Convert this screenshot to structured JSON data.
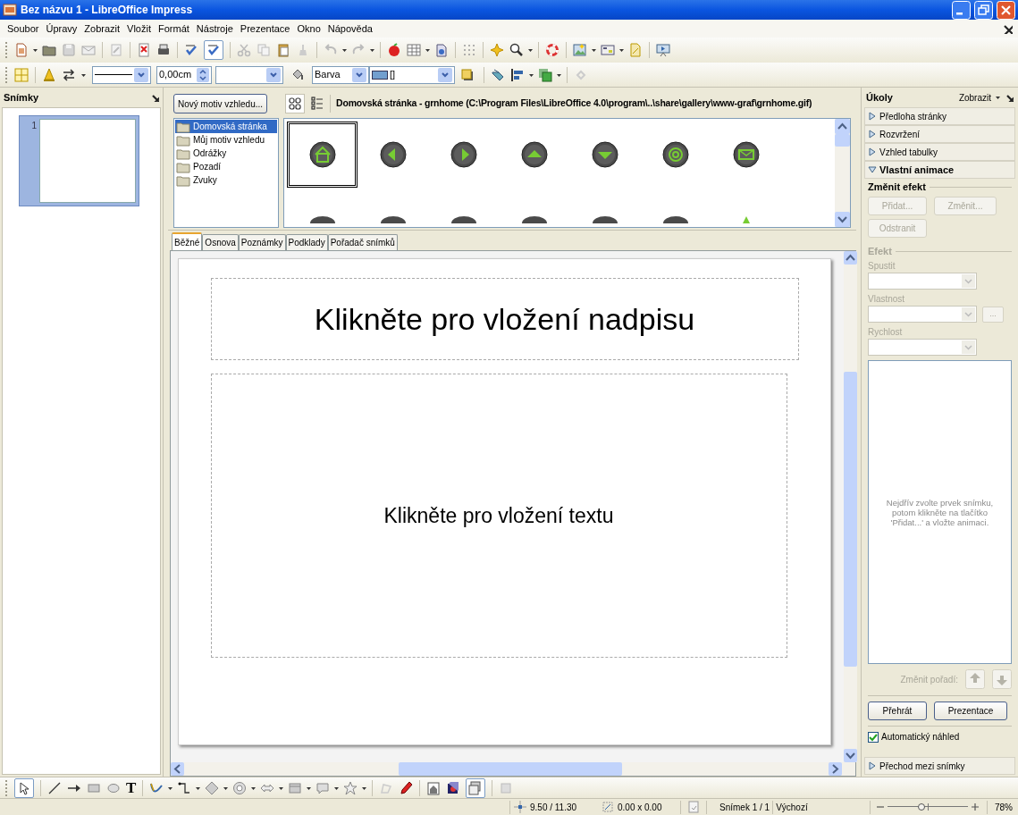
{
  "window": {
    "title": "Bez názvu 1 - LibreOffice Impress"
  },
  "menu": [
    {
      "label": "Soubor"
    },
    {
      "label": "Úpravy"
    },
    {
      "label": "Zobrazit"
    },
    {
      "label": "Vložit"
    },
    {
      "label": "Formát"
    },
    {
      "label": "Nástroje"
    },
    {
      "label": "Prezentace"
    },
    {
      "label": "Okno"
    },
    {
      "label": "Nápověda"
    }
  ],
  "format_toolbar": {
    "line_width": "0,00cm",
    "area_style": "Barva",
    "area_fill": "[]"
  },
  "slides_panel": {
    "title": "Snímky",
    "slides": [
      {
        "number": "1",
        "selected": true
      }
    ]
  },
  "gallery": {
    "new_theme_button": "Nový motiv vzhledu...",
    "title": "Domovská stránka - grnhome (C:\\Program Files\\LibreOffice 4.0\\program\\..\\share\\gallery\\www-graf\\grnhome.gif)",
    "themes": [
      {
        "label": "Domovská stránka",
        "selected": true
      },
      {
        "label": "Můj motiv vzhledu",
        "selected": false
      },
      {
        "label": "Odrážky",
        "selected": false
      },
      {
        "label": "Pozadí",
        "selected": false
      },
      {
        "label": "Zvuky",
        "selected": false
      }
    ]
  },
  "view_tabs": [
    {
      "label": "Běžné",
      "selected": true
    },
    {
      "label": "Osnova",
      "selected": false
    },
    {
      "label": "Poznámky",
      "selected": false
    },
    {
      "label": "Podklady",
      "selected": false
    },
    {
      "label": "Pořadač snímků",
      "selected": false
    }
  ],
  "slide": {
    "title_placeholder": "Klikněte pro vložení nadpisu",
    "text_placeholder": "Klikněte pro vložení textu"
  },
  "task_pane": {
    "title": "Úkoly",
    "view_menu": "Zobrazit",
    "sections": [
      {
        "label": "Předloha stránky",
        "expanded": false
      },
      {
        "label": "Rozvržení",
        "expanded": false
      },
      {
        "label": "Vzhled tabulky",
        "expanded": false
      },
      {
        "label": "Vlastní animace",
        "expanded": true
      },
      {
        "label": "Přechod mezi snímky",
        "expanded": false
      }
    ],
    "custom_animation": {
      "heading": "Změnit efekt",
      "buttons": [
        {
          "label": "Přidat...",
          "disabled": true
        },
        {
          "label": "Změnit...",
          "disabled": true
        },
        {
          "label": "Odstranit",
          "disabled": true
        }
      ],
      "effect_heading": "Efekt",
      "fields": [
        {
          "label": "Spustit",
          "disabled": true
        },
        {
          "label": "Vlastnost",
          "disabled": true,
          "options_button": "..."
        },
        {
          "label": "Rychlost",
          "disabled": true
        }
      ],
      "list_hint": "Nejdřív zvolte prvek snímku, potom klikněte na tlačítko 'Přidat...' a vložte animaci.",
      "reorder_label": "Změnit pořadí:",
      "reorder_disabled": true,
      "play_button": "Přehrát",
      "slideshow_button": "Prezentace",
      "auto_preview": {
        "label": "Automatický náhled",
        "checked": true
      }
    }
  },
  "drawing_toolbar": {
    "text_tool": "T"
  },
  "status_bar": {
    "position": "9.50 / 11.30",
    "size": "0.00 x 0.00",
    "slide": "Snímek 1 / 1",
    "master": "Výchozí",
    "zoom": {
      "level": 0.42
    },
    "zoom_percent": "78%"
  }
}
